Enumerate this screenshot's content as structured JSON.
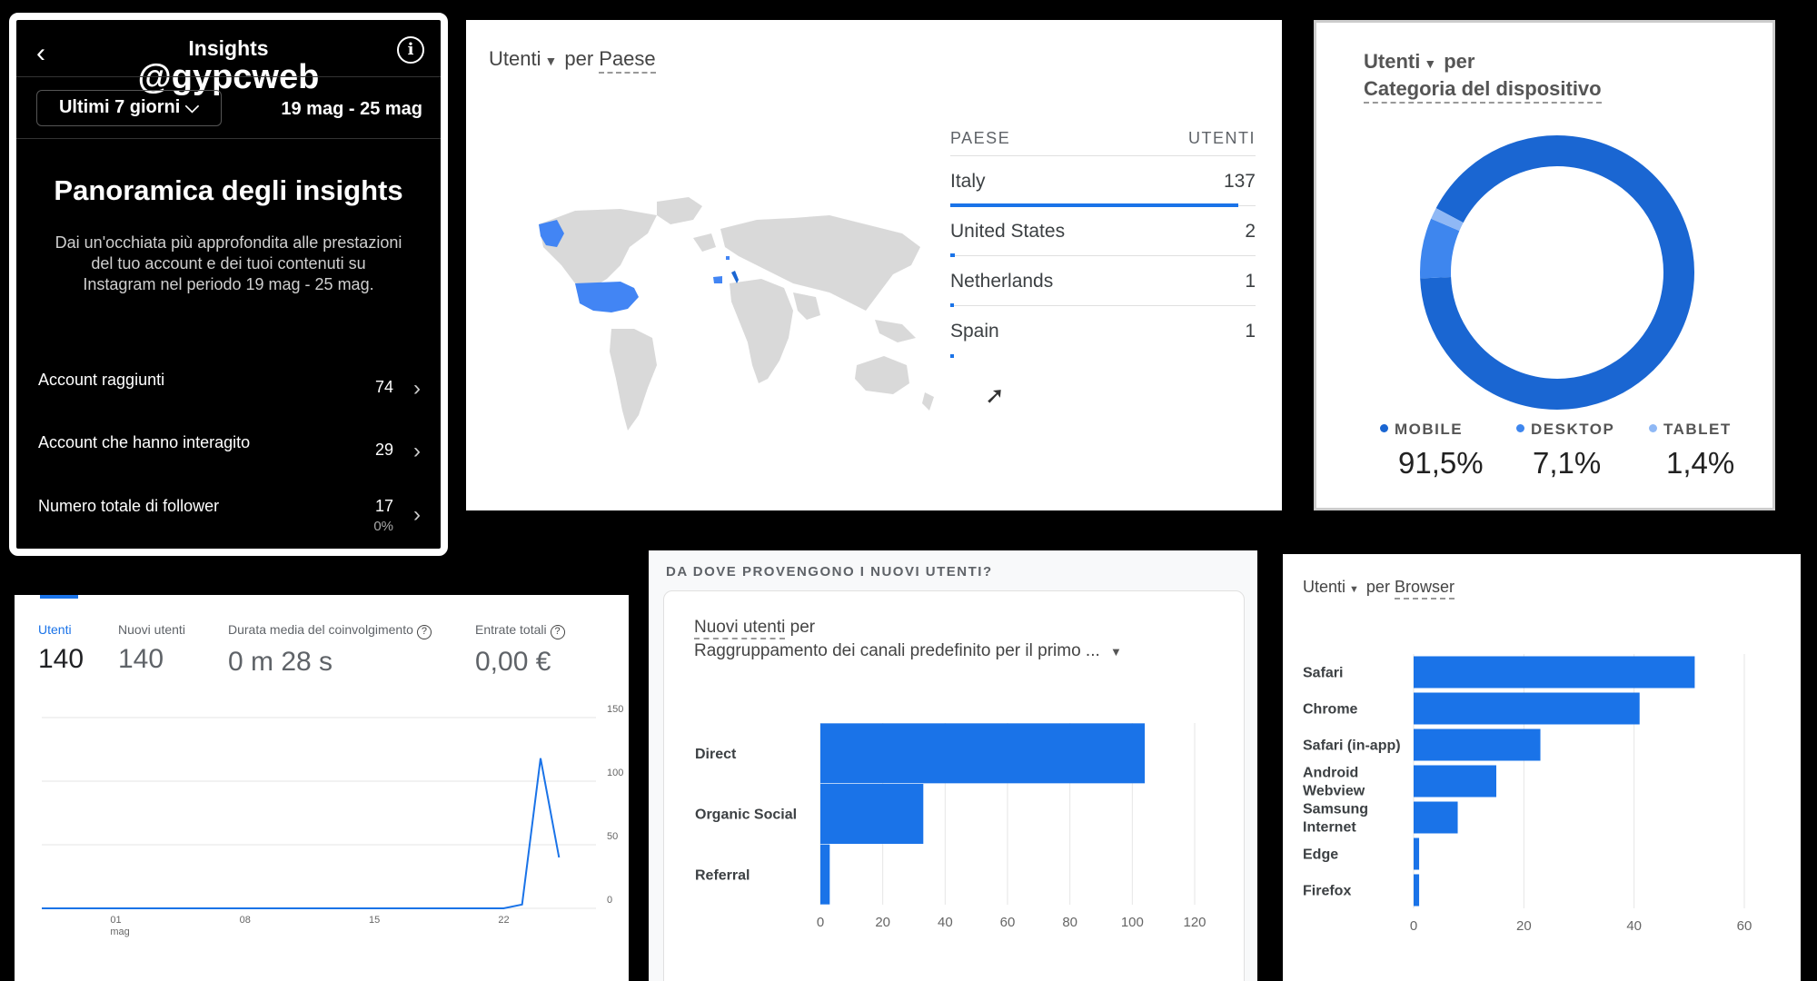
{
  "instagram": {
    "back_glyph": "‹",
    "title": "Insights",
    "watermark": "@gypcweb",
    "info_glyph": "i",
    "range_label": "Ultimi 7 giorni ⌵",
    "range_dates": "19 mag - 25 mag",
    "heading": "Panoramica degli insights",
    "description": "Dai un'occhiata più approfondita alle prestazioni del tuo account e dei tuoi contenuti su Instagram nel periodo 19 mag - 25 mag.",
    "rows": [
      {
        "label": "Account raggiunti",
        "value": "74",
        "sub": ""
      },
      {
        "label": "Account che hanno interagito",
        "value": "29",
        "sub": ""
      },
      {
        "label": "Numero totale di follower",
        "value": "17",
        "sub": "0%"
      }
    ],
    "chevron_glyph": "›"
  },
  "map_card": {
    "metric": "Utenti",
    "dimension_prefix": "per",
    "dimension": "Paese",
    "dropdown_glyph": "▼",
    "table_headers": {
      "country": "PAESE",
      "users": "UTENTI"
    },
    "rows": [
      {
        "country": "Italy",
        "users": "137",
        "share": 0.96
      },
      {
        "country": "United States",
        "users": "2",
        "share": 0.015
      },
      {
        "country": "Netherlands",
        "users": "1",
        "share": 0.008
      },
      {
        "country": "Spain",
        "users": "1",
        "share": 0.008
      }
    ],
    "highlight_color": "#4285f4",
    "cursor_glyph": "➚"
  },
  "device_card": {
    "metric": "Utenti",
    "dimension_prefix": "per",
    "dimension": "Categoria del dispositivo",
    "segments": [
      {
        "label": "MOBILE",
        "pct": "91,5%",
        "value": 91.5,
        "color": "#1a66d2"
      },
      {
        "label": "DESKTOP",
        "pct": "7,1%",
        "value": 7.1,
        "color": "#3e86ee"
      },
      {
        "label": "TABLET",
        "pct": "1,4%",
        "value": 1.4,
        "color": "#8fb8f5"
      }
    ]
  },
  "timeline_card": {
    "metrics": [
      {
        "label": "Utenti",
        "value": "140",
        "help": false,
        "active": true
      },
      {
        "label": "Nuovi utenti",
        "value": "140",
        "help": false,
        "active": false
      },
      {
        "label": "Durata media del coinvolgimento",
        "value": "0 m 28 s",
        "help": true,
        "active": false
      },
      {
        "label": "Entrate totali",
        "value": "0,00 €",
        "help": true,
        "active": false
      }
    ],
    "help_glyph": "?",
    "chart_data": {
      "type": "line",
      "x_ticks": [
        {
          "day": 1,
          "label": "01",
          "sub": "mag"
        },
        {
          "day": 8,
          "label": "08",
          "sub": ""
        },
        {
          "day": 15,
          "label": "15",
          "sub": ""
        },
        {
          "day": 22,
          "label": "22",
          "sub": ""
        }
      ],
      "y_ticks": [
        0,
        50,
        100,
        150
      ],
      "ylim": [
        0,
        150
      ],
      "xlim": [
        -3,
        27
      ],
      "series": [
        {
          "x": [
            -3,
            -2,
            -1,
            0,
            1,
            2,
            3,
            4,
            5,
            6,
            7,
            8,
            9,
            10,
            11,
            12,
            13,
            14,
            15,
            16,
            17,
            18,
            19,
            20,
            21,
            22,
            23,
            24,
            25
          ],
          "values": [
            0,
            0,
            0,
            0,
            0,
            0,
            0,
            0,
            0,
            0,
            0,
            0,
            0,
            0,
            0,
            0,
            0,
            0,
            0,
            0,
            0,
            0,
            0,
            0,
            0,
            0,
            3,
            118,
            40
          ],
          "color": "#1a73e8"
        }
      ]
    }
  },
  "channels_card": {
    "header": "DA DOVE PROVENGONO I NUOVI UTENTI?",
    "metric": "Nuovi utenti",
    "metric_suffix": "per",
    "dimension": "Raggruppamento dei canali predefinito per il primo ...",
    "dropdown_glyph": "▼",
    "chart_data": {
      "type": "bar",
      "orientation": "horizontal",
      "categories": [
        "Direct",
        "Organic Social",
        "Referral"
      ],
      "values": [
        104,
        33,
        3
      ],
      "x_ticks": [
        0,
        20,
        40,
        60,
        80,
        100,
        120
      ],
      "xlim": [
        0,
        120
      ],
      "color": "#1a73e8"
    }
  },
  "browser_card": {
    "metric": "Utenti",
    "dimension_prefix": "per",
    "dimension": "Browser",
    "dropdown_glyph": "▼",
    "chart_data": {
      "type": "bar",
      "orientation": "horizontal",
      "categories": [
        "Safari",
        "Chrome",
        "Safari (in-app)",
        "Android Webview",
        "Samsung Internet",
        "Edge",
        "Firefox"
      ],
      "category_lines": [
        [
          "Safari"
        ],
        [
          "Chrome"
        ],
        [
          "Safari (in-app)"
        ],
        [
          "Android",
          "Webview"
        ],
        [
          "Samsung",
          "Internet"
        ],
        [
          "Edge"
        ],
        [
          "Firefox"
        ]
      ],
      "values": [
        51,
        41,
        23,
        15,
        8,
        1,
        1
      ],
      "x_ticks": [
        0,
        20,
        40,
        60
      ],
      "xlim": [
        0,
        60
      ],
      "color": "#1a73e8"
    }
  }
}
